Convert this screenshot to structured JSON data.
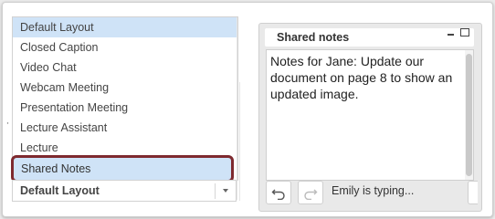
{
  "layout_menu": {
    "items": [
      {
        "label": "Default Layout",
        "selected": true
      },
      {
        "label": "Closed Caption",
        "selected": false
      },
      {
        "label": "Video Chat",
        "selected": false
      },
      {
        "label": "Webcam Meeting",
        "selected": false
      },
      {
        "label": "Presentation Meeting",
        "selected": false
      },
      {
        "label": "Lecture Assistant",
        "selected": false
      },
      {
        "label": "Lecture",
        "selected": false
      }
    ],
    "highlighted": "Shared Notes",
    "select_value": "Default Layout",
    "highlight_outline_color": "#7e2a2f",
    "selected_bg_color": "#cfe3f7"
  },
  "notes_panel": {
    "title": "Shared notes",
    "text": "Notes for Jane: Update our document on page 8 to show an updated image.",
    "typing_status": "Emily is typing...",
    "icons": [
      "minimize-icon",
      "maximize-icon",
      "undo-icon",
      "redo-icon"
    ]
  }
}
